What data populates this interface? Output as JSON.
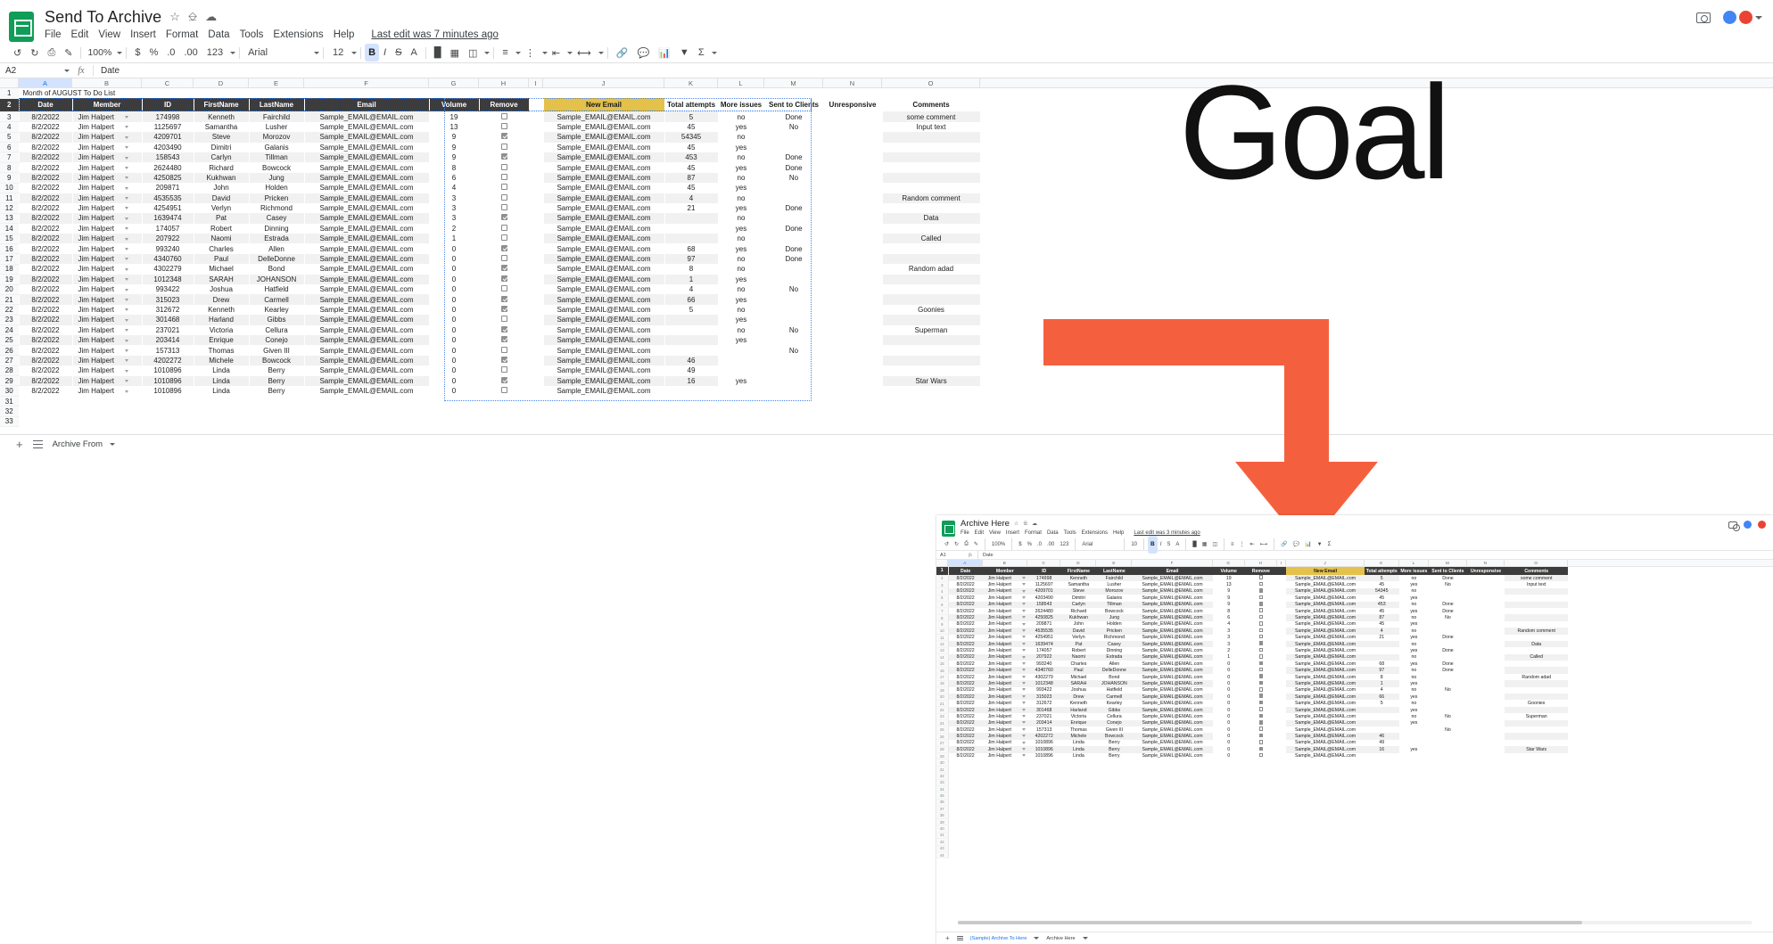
{
  "main": {
    "doc_title": "Send To Archive",
    "menus": [
      "File",
      "Edit",
      "View",
      "Insert",
      "Format",
      "Data",
      "Tools",
      "Extensions",
      "Help"
    ],
    "last_edit": "Last edit was 7 minutes ago",
    "toolbar": {
      "zoom": "100%",
      "number_format": "123",
      "font": "Arial",
      "font_size": "12",
      "bold": "B",
      "italic": "I",
      "strikethrough": "S",
      "text_color": "A"
    },
    "namebox": "A2",
    "formula_value": "Date",
    "sheet_title": "Month of AUGUST To Do List",
    "columns": [
      "A",
      "B",
      "C",
      "D",
      "E",
      "F",
      "G",
      "H",
      "I",
      "J",
      "K",
      "L",
      "M",
      "N",
      "O"
    ],
    "headers_left": [
      "Date",
      "Member",
      "ID",
      "FirstName",
      "LastName",
      "Email",
      "Volume",
      "Remove"
    ],
    "headers_right": [
      "New Email",
      "Total attempts",
      "More issues",
      "Sent to Clients",
      "Unresponsive",
      "Comments"
    ],
    "tabs": [
      {
        "label": "Archive From"
      }
    ],
    "add_sheet": "+",
    "all_sheets": "All sheets"
  },
  "annotation": {
    "goal_label": "Goal",
    "arrow_color": "#f4603e"
  },
  "inset": {
    "doc_title": "Archive Here",
    "menus": [
      "File",
      "Edit",
      "View",
      "Insert",
      "Format",
      "Data",
      "Tools",
      "Extensions",
      "Help"
    ],
    "last_edit": "Last edit was 3 minutes ago",
    "toolbar": {
      "zoom": "100%",
      "font": "Arial",
      "font_size": "10",
      "bold": "B",
      "italic": "I"
    },
    "namebox": "A1",
    "formula_value": "Date",
    "headers_left": [
      "Date",
      "Member",
      "ID",
      "FirstName",
      "LastName",
      "Email",
      "Volume",
      "Remove"
    ],
    "headers_right": [
      "New Email",
      "Total attempts",
      "More issues",
      "Sent to Clients",
      "Unresponsive",
      "Comments"
    ],
    "tabs": [
      {
        "label": "(Sample) Archive To Here",
        "active": true
      },
      {
        "label": "Archive Here",
        "active": false
      }
    ]
  },
  "rows": [
    {
      "n": 3,
      "date": "8/2/2022",
      "member": "Jim Halpert",
      "id": "174998",
      "first": "Kenneth",
      "last": "Fairchild",
      "email": "Sample_EMAIL@EMAIL.com",
      "volume": "19",
      "remove": false,
      "newemail": "Sample_EMAIL@EMAIL.com",
      "attempts": "5",
      "issues": "no",
      "sent": "Done",
      "unresp": "",
      "comments": "some comment"
    },
    {
      "n": 4,
      "date": "8/2/2022",
      "member": "Jim Halpert",
      "id": "1125697",
      "first": "Samantha",
      "last": "Lusher",
      "email": "Sample_EMAIL@EMAIL.com",
      "volume": "13",
      "remove": false,
      "newemail": "Sample_EMAIL@EMAIL.com",
      "attempts": "45",
      "issues": "yes",
      "sent": "No",
      "unresp": "",
      "comments": "Input text"
    },
    {
      "n": 5,
      "date": "8/2/2022",
      "member": "Jim Halpert",
      "id": "4209701",
      "first": "Steve",
      "last": "Morozov",
      "email": "Sample_EMAIL@EMAIL.com",
      "volume": "9",
      "remove": true,
      "newemail": "Sample_EMAIL@EMAIL.com",
      "attempts": "54345",
      "issues": "no",
      "sent": "",
      "unresp": "",
      "comments": ""
    },
    {
      "n": 6,
      "date": "8/2/2022",
      "member": "Jim Halpert",
      "id": "4203490",
      "first": "Dimitri",
      "last": "Galanis",
      "email": "Sample_EMAIL@EMAIL.com",
      "volume": "9",
      "remove": false,
      "newemail": "Sample_EMAIL@EMAIL.com",
      "attempts": "45",
      "issues": "yes",
      "sent": "",
      "unresp": "",
      "comments": ""
    },
    {
      "n": 7,
      "date": "8/2/2022",
      "member": "Jim Halpert",
      "id": "158543",
      "first": "Carlyn",
      "last": "Tillman",
      "email": "Sample_EMAIL@EMAIL.com",
      "volume": "9",
      "remove": true,
      "newemail": "Sample_EMAIL@EMAIL.com",
      "attempts": "453",
      "issues": "no",
      "sent": "Done",
      "unresp": "",
      "comments": ""
    },
    {
      "n": 8,
      "date": "8/2/2022",
      "member": "Jim Halpert",
      "id": "2624480",
      "first": "Richard",
      "last": "Bowcock",
      "email": "Sample_EMAIL@EMAIL.com",
      "volume": "8",
      "remove": false,
      "newemail": "Sample_EMAIL@EMAIL.com",
      "attempts": "45",
      "issues": "yes",
      "sent": "Done",
      "unresp": "",
      "comments": ""
    },
    {
      "n": 9,
      "date": "8/2/2022",
      "member": "Jim Halpert",
      "id": "4250825",
      "first": "Kukhwan",
      "last": "Jung",
      "email": "Sample_EMAIL@EMAIL.com",
      "volume": "6",
      "remove": false,
      "newemail": "Sample_EMAIL@EMAIL.com",
      "attempts": "87",
      "issues": "no",
      "sent": "No",
      "unresp": "",
      "comments": ""
    },
    {
      "n": 10,
      "date": "8/2/2022",
      "member": "Jim Halpert",
      "id": "209871",
      "first": "John",
      "last": "Holden",
      "email": "Sample_EMAIL@EMAIL.com",
      "volume": "4",
      "remove": false,
      "newemail": "Sample_EMAIL@EMAIL.com",
      "attempts": "45",
      "issues": "yes",
      "sent": "",
      "unresp": "",
      "comments": ""
    },
    {
      "n": 11,
      "date": "8/2/2022",
      "member": "Jim Halpert",
      "id": "4535535",
      "first": "David",
      "last": "Pricken",
      "email": "Sample_EMAIL@EMAIL.com",
      "volume": "3",
      "remove": false,
      "newemail": "Sample_EMAIL@EMAIL.com",
      "attempts": "4",
      "issues": "no",
      "sent": "",
      "unresp": "",
      "comments": "Random comment"
    },
    {
      "n": 12,
      "date": "8/2/2022",
      "member": "Jim Halpert",
      "id": "4254951",
      "first": "Verlyn",
      "last": "Richmond",
      "email": "Sample_EMAIL@EMAIL.com",
      "volume": "3",
      "remove": false,
      "newemail": "Sample_EMAIL@EMAIL.com",
      "attempts": "21",
      "issues": "yes",
      "sent": "Done",
      "unresp": "",
      "comments": ""
    },
    {
      "n": 13,
      "date": "8/2/2022",
      "member": "Jim Halpert",
      "id": "1639474",
      "first": "Pat",
      "last": "Casey",
      "email": "Sample_EMAIL@EMAIL.com",
      "volume": "3",
      "remove": true,
      "newemail": "Sample_EMAIL@EMAIL.com",
      "attempts": "",
      "issues": "no",
      "sent": "",
      "unresp": "",
      "comments": "Data"
    },
    {
      "n": 14,
      "date": "8/2/2022",
      "member": "Jim Halpert",
      "id": "174057",
      "first": "Robert",
      "last": "Dinning",
      "email": "Sample_EMAIL@EMAIL.com",
      "volume": "2",
      "remove": false,
      "newemail": "Sample_EMAIL@EMAIL.com",
      "attempts": "",
      "issues": "yes",
      "sent": "Done",
      "unresp": "",
      "comments": ""
    },
    {
      "n": 15,
      "date": "8/2/2022",
      "member": "Jim Halpert",
      "id": "207922",
      "first": "Naomi",
      "last": "Estrada",
      "email": "Sample_EMAIL@EMAIL.com",
      "volume": "1",
      "remove": false,
      "newemail": "Sample_EMAIL@EMAIL.com",
      "attempts": "",
      "issues": "no",
      "sent": "",
      "unresp": "",
      "comments": "Called"
    },
    {
      "n": 16,
      "date": "8/2/2022",
      "member": "Jim Halpert",
      "id": "993240",
      "first": "Charles",
      "last": "Allen",
      "email": "Sample_EMAIL@EMAIL.com",
      "volume": "0",
      "remove": true,
      "newemail": "Sample_EMAIL@EMAIL.com",
      "attempts": "68",
      "issues": "yes",
      "sent": "Done",
      "unresp": "",
      "comments": ""
    },
    {
      "n": 17,
      "date": "8/2/2022",
      "member": "Jim Halpert",
      "id": "4340760",
      "first": "Paul",
      "last": "DelleDonne",
      "email": "Sample_EMAIL@EMAIL.com",
      "volume": "0",
      "remove": false,
      "newemail": "Sample_EMAIL@EMAIL.com",
      "attempts": "97",
      "issues": "no",
      "sent": "Done",
      "unresp": "",
      "comments": ""
    },
    {
      "n": 18,
      "date": "8/2/2022",
      "member": "Jim Halpert",
      "id": "4302279",
      "first": "Michael",
      "last": "Bond",
      "email": "Sample_EMAIL@EMAIL.com",
      "volume": "0",
      "remove": true,
      "newemail": "Sample_EMAIL@EMAIL.com",
      "attempts": "8",
      "issues": "no",
      "sent": "",
      "unresp": "",
      "comments": "Random adad"
    },
    {
      "n": 19,
      "date": "8/2/2022",
      "member": "Jim Halpert",
      "id": "1012348",
      "first": "SARAH",
      "last": "JOHANSON",
      "email": "Sample_EMAIL@EMAIL.com",
      "volume": "0",
      "remove": true,
      "newemail": "Sample_EMAIL@EMAIL.com",
      "attempts": "1",
      "issues": "yes",
      "sent": "",
      "unresp": "",
      "comments": ""
    },
    {
      "n": 20,
      "date": "8/2/2022",
      "member": "Jim Halpert",
      "id": "993422",
      "first": "Joshua",
      "last": "Hatfield",
      "email": "Sample_EMAIL@EMAIL.com",
      "volume": "0",
      "remove": false,
      "newemail": "Sample_EMAIL@EMAIL.com",
      "attempts": "4",
      "issues": "no",
      "sent": "No",
      "unresp": "",
      "comments": ""
    },
    {
      "n": 21,
      "date": "8/2/2022",
      "member": "Jim Halpert",
      "id": "315023",
      "first": "Drew",
      "last": "Carmell",
      "email": "Sample_EMAIL@EMAIL.com",
      "volume": "0",
      "remove": true,
      "newemail": "Sample_EMAIL@EMAIL.com",
      "attempts": "66",
      "issues": "yes",
      "sent": "",
      "unresp": "",
      "comments": ""
    },
    {
      "n": 22,
      "date": "8/2/2022",
      "member": "Jim Halpert",
      "id": "312672",
      "first": "Kenneth",
      "last": "Kearley",
      "email": "Sample_EMAIL@EMAIL.com",
      "volume": "0",
      "remove": true,
      "newemail": "Sample_EMAIL@EMAIL.com",
      "attempts": "5",
      "issues": "no",
      "sent": "",
      "unresp": "",
      "comments": "Goonies"
    },
    {
      "n": 23,
      "date": "8/2/2022",
      "member": "Jim Halpert",
      "id": "301468",
      "first": "Harland",
      "last": "Gibbs",
      "email": "Sample_EMAIL@EMAIL.com",
      "volume": "0",
      "remove": false,
      "newemail": "Sample_EMAIL@EMAIL.com",
      "attempts": "",
      "issues": "yes",
      "sent": "",
      "unresp": "",
      "comments": ""
    },
    {
      "n": 24,
      "date": "8/2/2022",
      "member": "Jim Halpert",
      "id": "237021",
      "first": "Victoria",
      "last": "Cellura",
      "email": "Sample_EMAIL@EMAIL.com",
      "volume": "0",
      "remove": true,
      "newemail": "Sample_EMAIL@EMAIL.com",
      "attempts": "",
      "issues": "no",
      "sent": "No",
      "unresp": "",
      "comments": "Superman"
    },
    {
      "n": 25,
      "date": "8/2/2022",
      "member": "Jim Halpert",
      "id": "203414",
      "first": "Enrique",
      "last": "Conejo",
      "email": "Sample_EMAIL@EMAIL.com",
      "volume": "0",
      "remove": true,
      "newemail": "Sample_EMAIL@EMAIL.com",
      "attempts": "",
      "issues": "yes",
      "sent": "",
      "unresp": "",
      "comments": ""
    },
    {
      "n": 26,
      "date": "8/2/2022",
      "member": "Jim Halpert",
      "id": "157313",
      "first": "Thomas",
      "last": "Given III",
      "email": "Sample_EMAIL@EMAIL.com",
      "volume": "0",
      "remove": false,
      "newemail": "Sample_EMAIL@EMAIL.com",
      "attempts": "",
      "issues": "",
      "sent": "No",
      "unresp": "",
      "comments": ""
    },
    {
      "n": 27,
      "date": "8/2/2022",
      "member": "Jim Halpert",
      "id": "4202272",
      "first": "Michele",
      "last": "Bowcock",
      "email": "Sample_EMAIL@EMAIL.com",
      "volume": "0",
      "remove": true,
      "newemail": "Sample_EMAIL@EMAIL.com",
      "attempts": "46",
      "issues": "",
      "sent": "",
      "unresp": "",
      "comments": ""
    },
    {
      "n": 28,
      "date": "8/2/2022",
      "member": "Jim Halpert",
      "id": "1010896",
      "first": "Linda",
      "last": "Berry",
      "email": "Sample_EMAIL@EMAIL.com",
      "volume": "0",
      "remove": false,
      "newemail": "Sample_EMAIL@EMAIL.com",
      "attempts": "49",
      "issues": "",
      "sent": "",
      "unresp": "",
      "comments": ""
    },
    {
      "n": 29,
      "date": "8/2/2022",
      "member": "Jim Halpert",
      "id": "1010896",
      "first": "Linda",
      "last": "Berry",
      "email": "Sample_EMAIL@EMAIL.com",
      "volume": "0",
      "remove": true,
      "newemail": "Sample_EMAIL@EMAIL.com",
      "attempts": "16",
      "issues": "yes",
      "sent": "",
      "unresp": "",
      "comments": "Star Wars"
    },
    {
      "n": 30,
      "date": "8/2/2022",
      "member": "Jim Halpert",
      "id": "1010896",
      "first": "Linda",
      "last": "Berry",
      "email": "Sample_EMAIL@EMAIL.com",
      "volume": "0",
      "remove": false,
      "newemail": "Sample_EMAIL@EMAIL.com",
      "attempts": "",
      "issues": "",
      "sent": "",
      "unresp": "",
      "comments": ""
    }
  ]
}
